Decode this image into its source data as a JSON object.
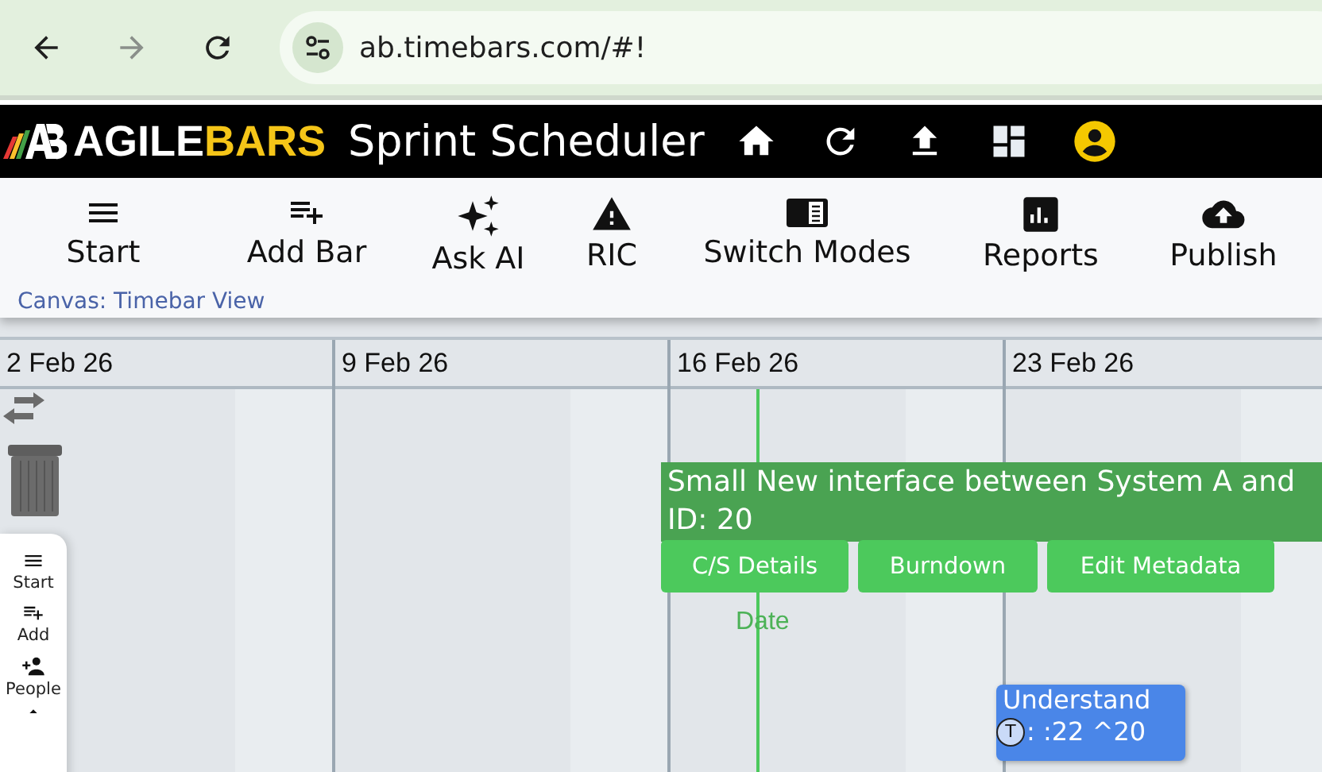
{
  "browser": {
    "url": "ab.timebars.com/#!"
  },
  "header": {
    "brand_start": "AGILE",
    "brand_end": "BARS",
    "app_title": "Sprint Scheduler"
  },
  "toolbar": {
    "items": [
      {
        "label": "Start"
      },
      {
        "label": "Add Bar"
      },
      {
        "label": "Ask AI"
      },
      {
        "label": "RIC"
      },
      {
        "label": "Switch Modes"
      },
      {
        "label": "Reports"
      },
      {
        "label": "Publish"
      }
    ],
    "canvas_label": "Canvas: Timebar View"
  },
  "timeline": {
    "weeks": [
      "2 Feb 26",
      "9 Feb 26",
      "16 Feb 26",
      "23 Feb 26"
    ],
    "report_date_label": "Date",
    "selected_bar": {
      "title": "Small New interface between System A and",
      "id_text": "ID: 20",
      "actions": [
        "C/S Details",
        "Burndown",
        "Edit Metadata"
      ]
    },
    "task_card": {
      "title": "Understand",
      "detail": ": :22 ^20",
      "type_badge": "T"
    }
  },
  "side_panel": {
    "items": [
      {
        "label": "Start"
      },
      {
        "label": "Add"
      },
      {
        "label": "People"
      }
    ]
  }
}
